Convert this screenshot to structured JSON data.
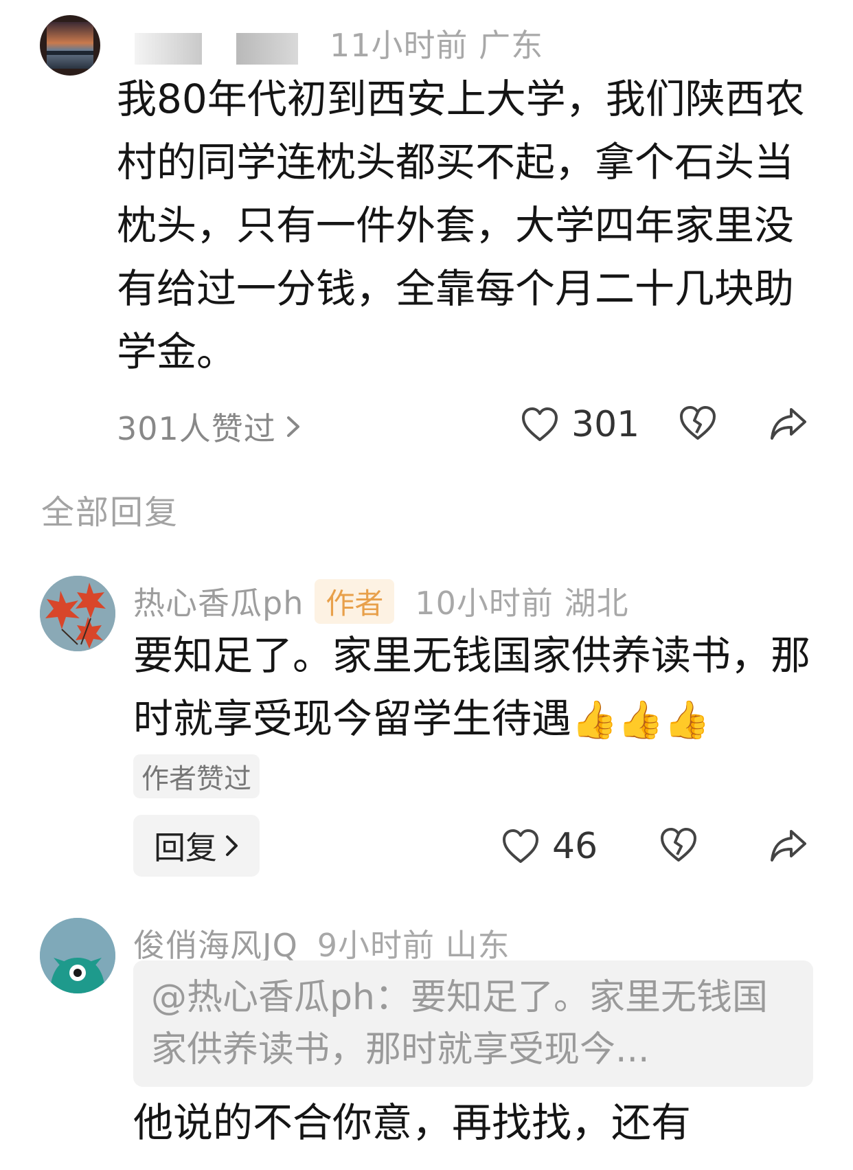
{
  "comment1": {
    "meta": "11小时前  广东",
    "text": "我80年代初到西安上大学，我们陕西农村的同学连枕头都买不起，拿个石头当枕头，只有一件外套，大学四年家里没有给过一分钱，全靠每个月二十几块助学金。",
    "liked_by": "301人赞过",
    "like_count": "301"
  },
  "section_title": "全部回复",
  "reply1": {
    "username": "热心香瓜ph",
    "author_badge": "作者",
    "meta": "10小时前  湖北",
    "text": "要知足了。家里无钱国家供养读书，那时就享受现今留学生待遇",
    "author_liked": "作者赞过",
    "reply_button": "回复",
    "like_count": "46"
  },
  "reply2": {
    "username": "俊俏海风JQ",
    "meta": "9小时前  山东",
    "quote": "@热心香瓜ph：要知足了。家里无钱国家供养读书，那时就享受现今...",
    "text": "他说的不合你意，再找找，还有"
  }
}
